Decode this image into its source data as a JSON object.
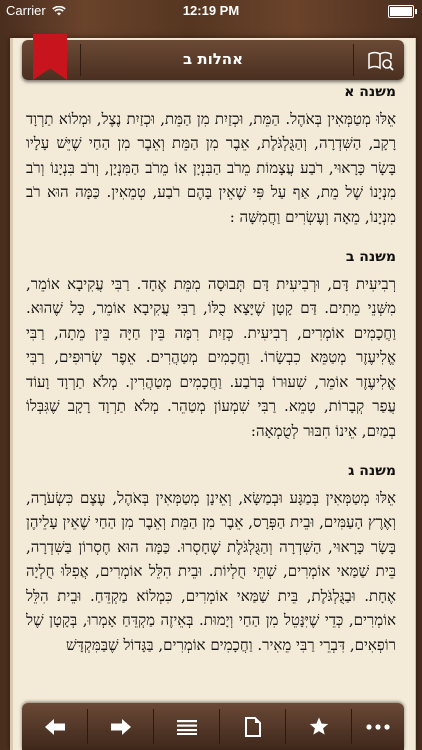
{
  "status_bar": {
    "carrier": "Carrier",
    "time": "12:19 PM"
  },
  "header": {
    "title": "אהלות ב"
  },
  "mishnayot": [
    {
      "heading": "משנה א",
      "text": "אֵלּוּ מְטַמְּאִין בְּאֹהֶל. הַמֵּת, וּכְזַיִת מִן הַמֵּת, וּכְזַיִת נֶצֶל, וּמְלוֹא תַרְוָד רָקָב, הַשִּׁדְרָה, וְהַגֻּלְגֹּלֶת, אֵבֶר מִן הַמֵּת וְאֵבֶר מִן הַחַי שֶׁיֵּשׁ עָלָיו בָּשָׂר כָּרָאוּי, רֹבַע עֲצָמוֹת מֵרֹב הַבִּנְיָן אוֹ מֵרֹב הַמִּנְיָן, וְרֹב בִּנְיָנוֹ וְרֹב מִנְיָנוֹ שֶׁל מֵת, אַף עַל פִּי שֶׁאֵין בָּהֶם רֹבַע, טְמֵאִין. כַּמָּה הוּא רֹב מִנְיָנוֹ, מֵאָה וְעֶשְׂרִים וַחֲמִשָּׁה :"
    },
    {
      "heading": "משנה ב",
      "text": "רְבִיעִית דָּם, וּרְבִיעִית דָּם תְּבוּסָה מִמֵּת אֶחָד. רַבִּי עֲקִיבָא אוֹמֵר, מִשְּׁנֵי מֵתִים. דַּם קָטָן שֶׁיָּצָא כֻלּוֹ, רַבִּי עֲקִיבָא אוֹמֵר, כָּל שֶׁהוּא. וַחֲכָמִים אוֹמְרִים, רְבִיעִית. כְּזַיִת רִמָּה בֵּין חַיָּה בֵּין מֵתָה, רַבִּי אֱלִיעֶזֶר מְטַמֵּא כִבְשָׂרוֹ. וַחֲכָמִים מְטַהֲרִים. אֵפֶר שְׂרוּפִים, רַבִּי אֱלִיעֶזֶר אוֹמֵר, שִׁעוּרוֹ בְּרֹבַע. וַחֲכָמִים מְטַהֲרִין. מְלֹא תַרְוָד וָעוֹד עֲפַר קְבָרוֹת, טָמֵא. רַבִּי שִׁמְעוֹן מְטַהֵר. מְלֹא תַרְוָד רָקָב שֶׁגִּבְּלוֹ בְמַיִם, אֵינוֹ חִבּוּר לְטֻמְאָה:"
    },
    {
      "heading": "משנה ג",
      "text": "אֵלּוּ מְטַמְּאִין בְּמַגָּע וּבְמַשָּׂא, וְאֵינָן מְטַמְּאִין בְּאֹהֶל, עֶצֶם כִּשְׂעֹרָה, וְאֶרֶץ הָעַמִּים, וּבֵית הַפְּרָס, אֵבֶר מִן הַמֵּת וְאֵבֶר מִן הַחַי שֶׁאֵין עָלֵיהֶן בָּשָׂר כָּרָאוּי, הַשִּׁדְרָה וְהַגֻּלְגֹּלֶת שֶׁחָסְרוּ. כַּמָּה הוּא חֶסְרוֹן בַּשִּׁדְרָה, בֵּית שַׁמַּאי אוֹמְרִים, שְׁתֵּי חֻלְיוֹת. וּבֵית הִלֵּל אוֹמְרִים, אֲפִלּוּ חֻלְיָה אֶחָת. וּבַגֻּלְגֹּלֶת, בֵּית שַׁמַּאי אוֹמְרִים, כִּמְלוֹא מַקְדֵּחַ. וּבֵית הִלֵּל אוֹמְרִים, כְּדֵי שֶׁיִּנָּטֵל מִן הַחַי וְיָמוּת. בְּאֵיזֶה מַקְדֵּחַ אָמְרוּ, בְּקָטָן שֶׁל רוֹפְאִים, דִּבְרֵי רַבִּי מֵאִיר. וַחֲכָמִים אוֹמְרִים, בַּגָּדוֹל שֶׁבַּמִּקְדָּשׁ"
    }
  ],
  "toolbar": {
    "icons": [
      "arrow-left-icon",
      "arrow-right-icon",
      "list-icon",
      "page-icon",
      "star-icon",
      "more-icon"
    ]
  }
}
